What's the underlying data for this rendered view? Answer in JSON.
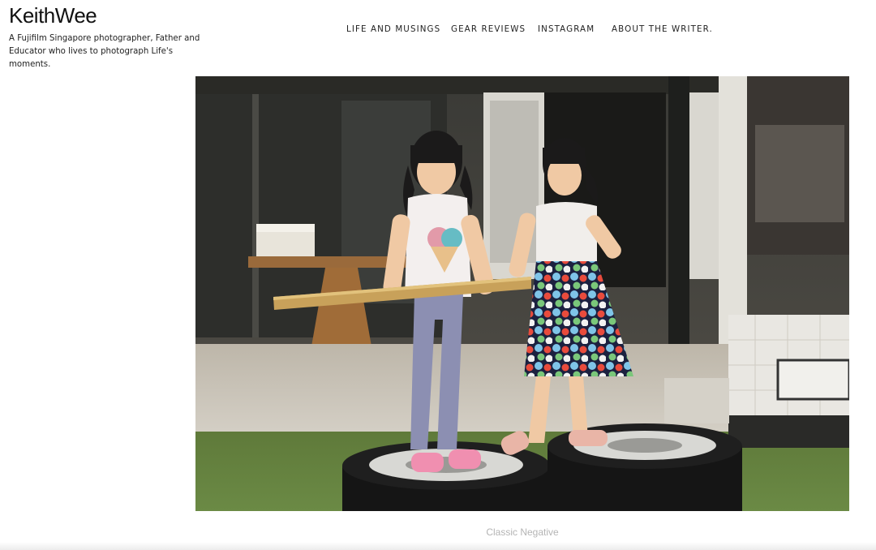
{
  "site": {
    "title": "KeithWee",
    "tagline": "A Fujifilm Singapore photographer, Father and Educator who lives to photograph Life's moments."
  },
  "nav": {
    "items": [
      {
        "label": "LIFE AND MUSINGS"
      },
      {
        "label": "GEAR REVIEWS"
      },
      {
        "label": "INSTAGRAM"
      },
      {
        "label": "ABOUT THE WRITER."
      }
    ]
  },
  "post": {
    "image_description": "Two young girls standing on car tires in front of a house, holding a wooden ruler",
    "caption": "Classic Negative"
  }
}
